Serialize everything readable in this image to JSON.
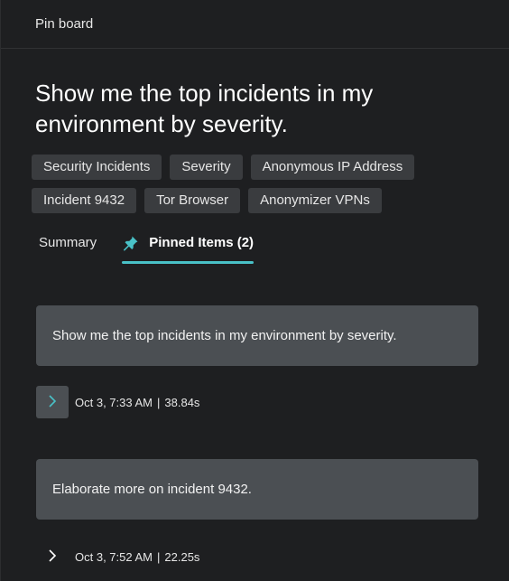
{
  "header": {
    "title": "Pin board"
  },
  "prompt_heading": "Show me the top incidents in my environment by severity.",
  "tags": [
    "Security Incidents",
    "Severity",
    "Anonymous IP Address",
    "Incident 9432",
    "Tor Browser",
    "Anonymizer VPNs"
  ],
  "tabs": {
    "summary_label": "Summary",
    "pinned_label": "Pinned Items (2)",
    "active": "pinned"
  },
  "pinned_items": [
    {
      "text": "Show me the top incidents in my environment by severity.",
      "timestamp": "Oct 3, 7:33 AM",
      "duration": "38.84s",
      "chevron_highlighted": true
    },
    {
      "text": "Elaborate more on incident 9432.",
      "timestamp": "Oct 3, 7:52 AM",
      "duration": "22.25s",
      "chevron_highlighted": false
    }
  ],
  "separator": "|",
  "colors": {
    "accent": "#49c1c7",
    "background": "#1e1f21",
    "card": "#4b4f53",
    "tag": "#3a3c3f"
  }
}
